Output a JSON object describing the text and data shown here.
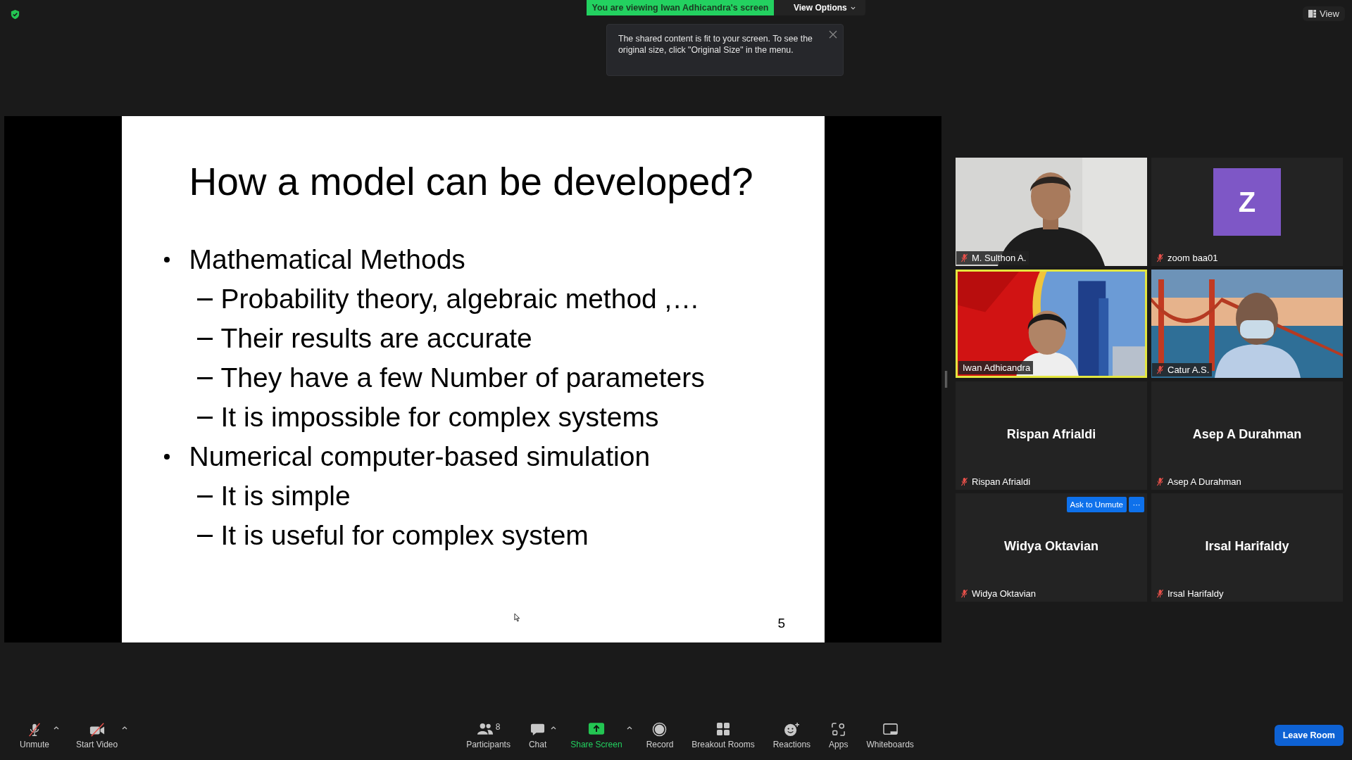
{
  "share_banner": {
    "text": "You are viewing Iwan Adhicandra's screen",
    "view_options": "View Options"
  },
  "tooltip": {
    "text": "The shared content is fit to your screen. To see the original size, click \"Original Size\" in the menu."
  },
  "view_button": "View",
  "slide": {
    "title": "How a model can be developed?",
    "bullets": [
      {
        "text": "Mathematical Methods",
        "children": [
          {
            "text": "Probability theory, algebraic method ,…"
          },
          {
            "text": "Their results are accurate"
          },
          {
            "text": "They have a few Number of parameters"
          },
          {
            "text": "It is impossible for complex systems"
          }
        ]
      },
      {
        "text": "Numerical computer-based simulation",
        "children": [
          {
            "text": "It is simple"
          },
          {
            "text": "It is useful for complex system"
          }
        ]
      }
    ],
    "page_number": "5"
  },
  "participants": [
    {
      "kind": "video",
      "name": "M. Sulthon A.",
      "muted": true,
      "speaking": false
    },
    {
      "kind": "avatar",
      "name": "zoom baa01",
      "letter": "Z",
      "muted": true,
      "speaking": false
    },
    {
      "kind": "video",
      "name": "Iwan Adhicandra",
      "muted": false,
      "speaking": true
    },
    {
      "kind": "video",
      "name": "Catur A.S.",
      "muted": true,
      "speaking": false
    },
    {
      "kind": "name",
      "name": "Rispan Afrialdi",
      "center_name": "Rispan Afrialdi",
      "muted": true,
      "speaking": false
    },
    {
      "kind": "name",
      "name": "Asep A Durahman",
      "center_name": "Asep A Durahman",
      "muted": true,
      "speaking": false
    },
    {
      "kind": "name",
      "name": "Widya Oktavian",
      "center_name": "Widya Oktavian",
      "muted": true,
      "speaking": false,
      "hover_actions": {
        "button": "Ask to Unmute",
        "more": "···"
      }
    },
    {
      "kind": "name",
      "name": "Irsal Harifaldy",
      "center_name": "Irsal Harifaldy",
      "muted": true,
      "speaking": false
    }
  ],
  "toolbar": {
    "left": [
      {
        "kind": "mic",
        "label": "Unmute",
        "caret": true
      },
      {
        "kind": "video",
        "label": "Start Video",
        "caret": true
      }
    ],
    "center": [
      {
        "kind": "people",
        "label": "Participants",
        "count": "8",
        "caret": false
      },
      {
        "kind": "chat",
        "label": "Chat",
        "caret": true
      },
      {
        "kind": "share",
        "label": "Share Screen",
        "caret": true
      },
      {
        "kind": "record",
        "label": "Record",
        "caret": false
      },
      {
        "kind": "rooms",
        "label": "Breakout Rooms",
        "caret": false
      },
      {
        "kind": "reactions",
        "label": "Reactions",
        "caret": false
      },
      {
        "kind": "apps",
        "label": "Apps",
        "caret": false
      },
      {
        "kind": "whiteboard",
        "label": "Whiteboards",
        "caret": false
      }
    ],
    "leave": "Leave Room"
  }
}
